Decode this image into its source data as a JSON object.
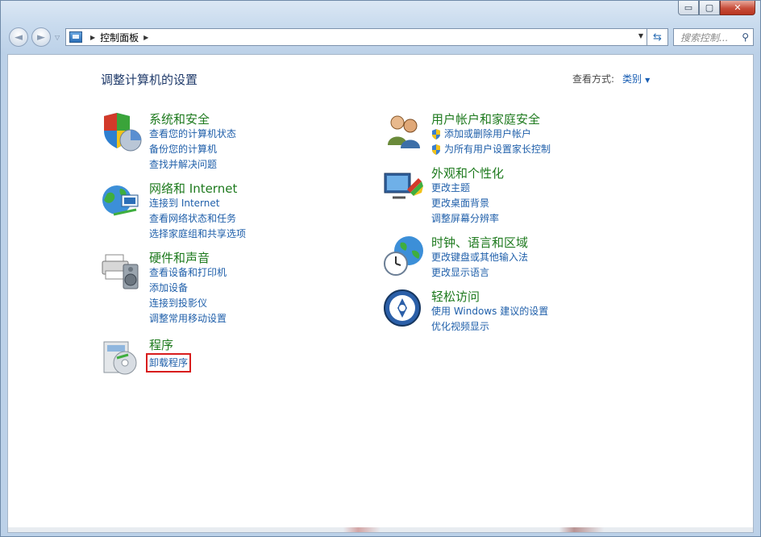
{
  "titlebar": {
    "buttons": {
      "minimize": "▭",
      "maximize": "▢",
      "close": "✕"
    }
  },
  "navbar": {
    "back_icon": "◄",
    "forward_icon": "►",
    "recent_icon": "▽",
    "address": {
      "root_icon": "control-panel-icon",
      "crumb": "控制面板",
      "separator": "▶",
      "dropdown": "▼"
    },
    "refresh_icon": "⇆",
    "search": {
      "placeholder": "搜索控制...",
      "icon": "⚲"
    }
  },
  "content": {
    "heading": "调整计算机的设置",
    "view_by": {
      "label": "查看方式:",
      "value": "类别",
      "arrow": "▼"
    },
    "categories": [
      {
        "title": "系统和安全",
        "icon": "shield-chart-icon",
        "links": [
          "查看您的计算机状态",
          "备份您的计算机",
          "查找并解决问题"
        ]
      },
      {
        "title": "网络和 Internet",
        "icon": "network-globe-icon",
        "links": [
          "连接到 Internet",
          "查看网络状态和任务",
          "选择家庭组和共享选项"
        ]
      },
      {
        "title": "硬件和声音",
        "icon": "printer-speaker-icon",
        "links": [
          "查看设备和打印机",
          "添加设备",
          "连接到投影仪",
          "调整常用移动设置"
        ]
      },
      {
        "title": "程序",
        "icon": "programs-disc-icon",
        "links": [
          "卸载程序"
        ]
      },
      {
        "title": "用户帐户和家庭安全",
        "icon": "users-icon",
        "links": [
          "添加或删除用户帐户",
          "为所有用户设置家长控制"
        ]
      },
      {
        "title": "外观和个性化",
        "icon": "monitor-palette-icon",
        "links": [
          "更改主题",
          "更改桌面背景",
          "调整屏幕分辨率"
        ]
      },
      {
        "title": "时钟、语言和区域",
        "icon": "clock-globe-icon",
        "links": [
          "更改键盘或其他输入法",
          "更改显示语言"
        ]
      },
      {
        "title": "轻松访问",
        "icon": "ease-of-access-icon",
        "links": [
          "使用 Windows 建议的设置",
          "优化视频显示"
        ]
      }
    ]
  },
  "colors": {
    "category_title": "#1e7a1e",
    "link": "#1f5faa",
    "heading": "#1f3a6a",
    "highlight": "#d81d1d"
  }
}
